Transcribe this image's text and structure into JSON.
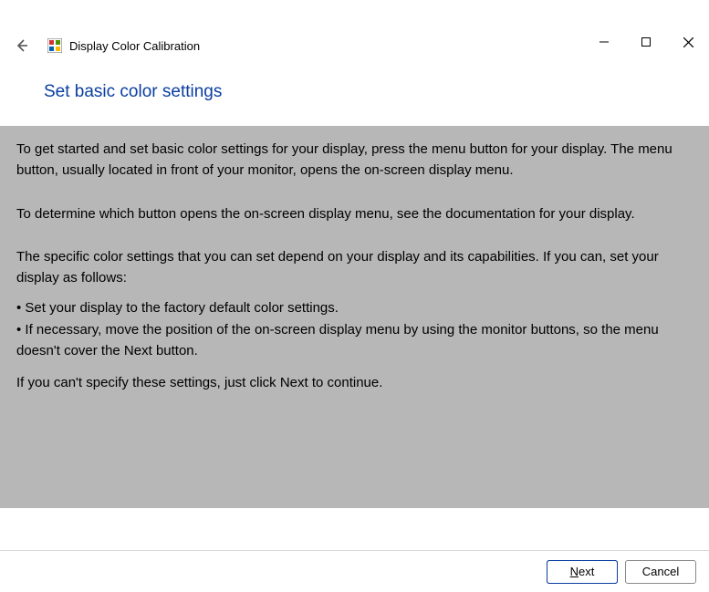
{
  "window": {
    "app_title": "Display Color Calibration"
  },
  "heading": "Set basic color settings",
  "content": {
    "p1": "To get started and set basic color settings for your display, press the menu button for your display. The menu button, usually located in front of your monitor, opens the on-screen display menu.",
    "p2": "To determine which button opens the on-screen display menu, see the documentation for your display.",
    "p3": "The specific color settings that you can set depend on your display and its capabilities. If you can, set your display as follows:",
    "b1": "• Set your display to the factory default color settings.",
    "b2": "• If necessary, move the position of the on-screen display menu by using the monitor buttons, so the menu doesn't cover the Next button.",
    "p4": "If you can't specify these settings,  just click Next to continue."
  },
  "footer": {
    "next_label": "Next",
    "cancel_label": "Cancel"
  }
}
